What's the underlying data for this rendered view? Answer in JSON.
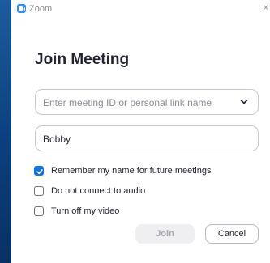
{
  "window": {
    "title": "Zoom",
    "close_glyph": "×"
  },
  "dialog": {
    "heading": "Join Meeting",
    "meeting_id_field": {
      "placeholder": "Enter meeting ID or personal link name",
      "value": ""
    },
    "name_field": {
      "value": "Bobby"
    },
    "options": [
      {
        "label": "Remember my name for future meetings",
        "checked": true
      },
      {
        "label": "Do not connect to audio",
        "checked": false
      },
      {
        "label": "Turn off my video",
        "checked": false
      }
    ],
    "join_label": "Join",
    "cancel_label": "Cancel"
  },
  "colors": {
    "accent": "#0e72ed",
    "brand": "#2d8cff",
    "disabled_button": "#efeff2"
  },
  "icons": {
    "app": "zoom-logo-icon",
    "dropdown": "chevron-down-icon",
    "check": "check-icon",
    "close": "close-icon"
  }
}
